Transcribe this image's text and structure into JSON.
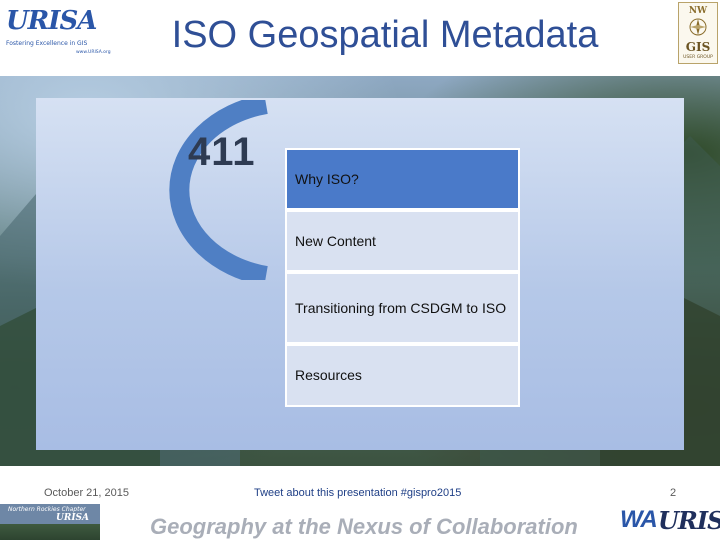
{
  "header": {
    "logo_left": {
      "name": "URISA",
      "tagline": "Fostering Excellence in GIS",
      "url": "www.URISA.org"
    },
    "title": "ISO Geospatial Metadata",
    "logo_right": {
      "top": "NW",
      "main": "GIS",
      "sub": "USER GROUP"
    }
  },
  "content": {
    "logo_number": "411",
    "menu": [
      {
        "label": "Why ISO?",
        "active": true
      },
      {
        "label": "New Content",
        "active": false
      },
      {
        "label": "Transitioning from CSDGM to ISO",
        "active": false
      },
      {
        "label": "Resources",
        "active": false
      }
    ]
  },
  "footer": {
    "date": "October 21, 2015",
    "tweet": "Tweet about this presentation #gispro2015",
    "page": "2",
    "chapter_logo": {
      "line1": "Northern Rockies Chapter",
      "line2": "URISA"
    },
    "tagline": "Geography at the Nexus of Collaboration",
    "wa_logo": {
      "prefix": "WA",
      "suffix": "URISA"
    }
  },
  "colors": {
    "title": "#2f4f96",
    "active_item": "#4a7ac9",
    "item_bg": "#d9e1f1",
    "logo_arc": "#4f7fc4"
  }
}
